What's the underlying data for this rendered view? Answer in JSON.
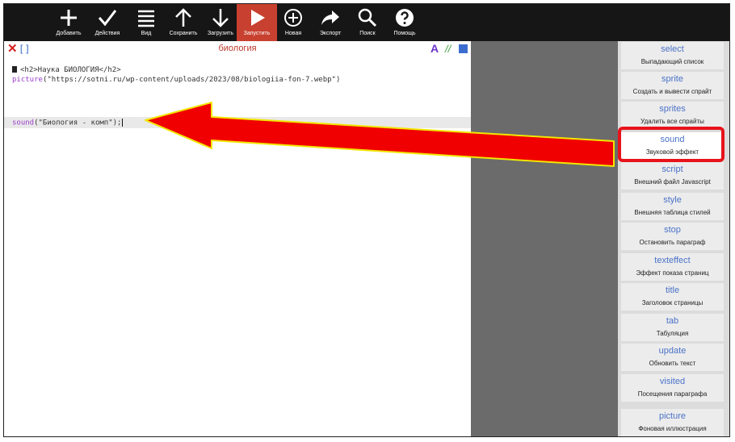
{
  "toolbar": {
    "items": [
      {
        "label": "Добавить",
        "icon": "plus-icon"
      },
      {
        "label": "Действия",
        "icon": "check-icon"
      },
      {
        "label": "Вид",
        "icon": "list-icon"
      },
      {
        "label": "Сохранить",
        "icon": "arrow-up-icon"
      },
      {
        "label": "Загрузить",
        "icon": "arrow-down-icon"
      },
      {
        "label": "Запустить",
        "icon": "play-icon"
      },
      {
        "label": "Новая",
        "icon": "plus-circle-icon"
      },
      {
        "label": "Экспорт",
        "icon": "share-icon"
      },
      {
        "label": "Поиск",
        "icon": "search-icon"
      },
      {
        "label": "Помощь",
        "icon": "help-icon"
      }
    ],
    "active_index": 5,
    "active_color": "#c8402f"
  },
  "editor": {
    "title": "биология",
    "close_symbol": "✕",
    "bracket_symbol": "[]",
    "font_symbol": "A",
    "comment_symbol": "//",
    "lines": {
      "line1": "<h2>Наука БИОЛОГИЯ</h2>",
      "line2_func": "picture",
      "line2_args": "(\"https://sotni.ru/wp-content/uploads/2023/08/biologiia-fon-7.webp\")",
      "line3_func": "sound",
      "line3_args": "(\"Биология - комп\");"
    }
  },
  "sidebar": {
    "items": [
      {
        "key": "select",
        "desc": "Выпадающий список"
      },
      {
        "key": "sprite",
        "desc": "Создать и вывести спрайт"
      },
      {
        "key": "sprites",
        "desc": "Удалить все спрайты"
      },
      {
        "key": "sound",
        "desc": "Звуковой эффект"
      },
      {
        "key": "script",
        "desc": "Внешний файл Javascript"
      },
      {
        "key": "style",
        "desc": "Внешняя таблица стилей"
      },
      {
        "key": "stop",
        "desc": "Остановить параграф"
      },
      {
        "key": "texteffect",
        "desc": "Эффект показа страниц"
      },
      {
        "key": "title",
        "desc": "Заголовок страницы"
      },
      {
        "key": "tab",
        "desc": "Табуляция"
      },
      {
        "key": "update",
        "desc": "Обновить текст"
      },
      {
        "key": "visited",
        "desc": "Посещения параграфа"
      },
      {
        "key": "picture",
        "desc": "Фоновая иллюстрация"
      }
    ],
    "highlighted_index": 3,
    "highlight_color": "#e8131a"
  },
  "annotation": {
    "arrow_color": "#f00000",
    "arrow_outline": "#f2e600"
  }
}
